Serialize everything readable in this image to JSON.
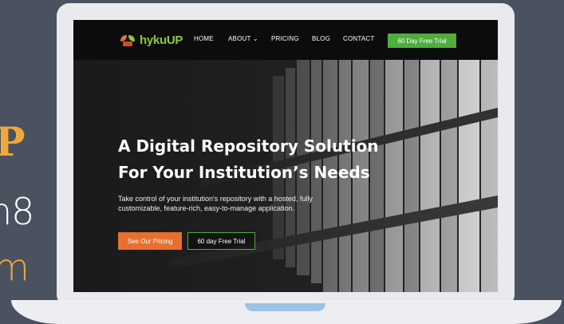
{
  "side": {
    "p": "P",
    "n8": "n8",
    "m": "m"
  },
  "nav": {
    "logo_part1": "hyku",
    "logo_part2": "UP",
    "items": [
      {
        "label": "HOME"
      },
      {
        "label": "ABOUT ⌄"
      },
      {
        "label": "PRICING"
      },
      {
        "label": "BLOG"
      },
      {
        "label": "CONTACT"
      }
    ],
    "cta": "60 Day Free Trial"
  },
  "hero": {
    "title_line1": "A Digital Repository Solution",
    "title_line2": "For Your Institution’s Needs",
    "subtitle": "Take control of your institution's repository with a hosted, fully customizable, feature-rich, easy-to-manage application.",
    "primary_button": "See Our Pricing",
    "secondary_button": "60 day Free Trial"
  },
  "colors": {
    "background": "#4a5260",
    "accent_orange": "#e8702e",
    "accent_green": "#4fae3b",
    "side_text_orange": "#f2a73b"
  }
}
